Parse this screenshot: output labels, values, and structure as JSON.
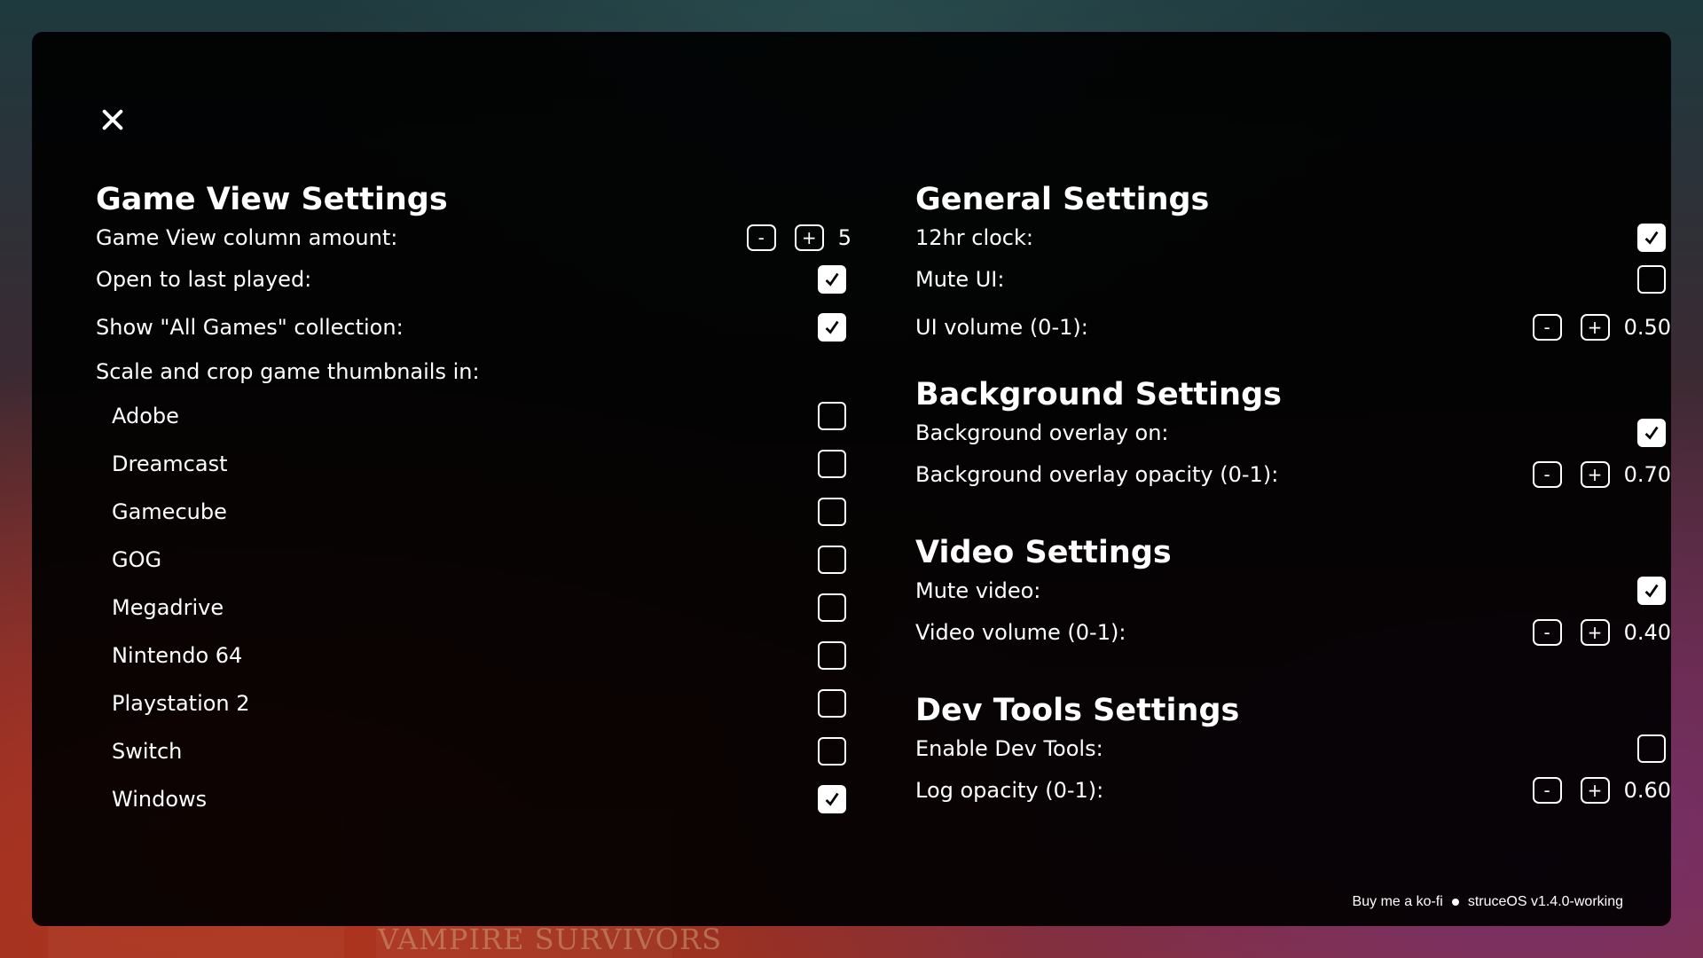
{
  "close_icon": "close-icon",
  "game_view": {
    "title": "Game View Settings",
    "column_amount": {
      "label": "Game View column amount:",
      "minus": "-",
      "plus": "+",
      "value": "5"
    },
    "open_last_played": {
      "label": "Open to last played:",
      "checked": true
    },
    "show_all_games": {
      "label": "Show \"All Games\" collection:",
      "checked": true
    },
    "scale_crop_label": "Scale and crop game thumbnails in:",
    "platforms": [
      {
        "label": "Adobe",
        "checked": false
      },
      {
        "label": "Dreamcast",
        "checked": false
      },
      {
        "label": "Gamecube",
        "checked": false
      },
      {
        "label": "GOG",
        "checked": false
      },
      {
        "label": "Megadrive",
        "checked": false
      },
      {
        "label": "Nintendo 64",
        "checked": false
      },
      {
        "label": "Playstation 2",
        "checked": false
      },
      {
        "label": "Switch",
        "checked": false
      },
      {
        "label": "Windows",
        "checked": true
      }
    ]
  },
  "general": {
    "title": "General Settings",
    "clock_12hr": {
      "label": "12hr clock:",
      "checked": true
    },
    "mute_ui": {
      "label": "Mute UI:",
      "checked": false
    },
    "ui_volume": {
      "label": "UI volume (0-1):",
      "minus": "-",
      "plus": "+",
      "value": "0.50"
    }
  },
  "background": {
    "title": "Background Settings",
    "overlay_on": {
      "label": "Background overlay on:",
      "checked": true
    },
    "overlay_opacity": {
      "label": "Background overlay opacity (0-1):",
      "minus": "-",
      "plus": "+",
      "value": "0.70"
    }
  },
  "video": {
    "title": "Video Settings",
    "mute_video": {
      "label": "Mute video:",
      "checked": true
    },
    "video_volume": {
      "label": "Video volume (0-1):",
      "minus": "-",
      "plus": "+",
      "value": "0.40"
    }
  },
  "dev_tools": {
    "title": "Dev Tools Settings",
    "enable": {
      "label": "Enable Dev Tools:",
      "checked": false
    },
    "log_opacity": {
      "label": "Log opacity (0-1):",
      "minus": "-",
      "plus": "+",
      "value": "0.60"
    }
  },
  "footer": {
    "kofi_link": "Buy me a ko-fi",
    "version": "struceOS v1.4.0-working"
  },
  "background_art": {
    "visible_title": "VAMPIRE SURVIVORS"
  }
}
